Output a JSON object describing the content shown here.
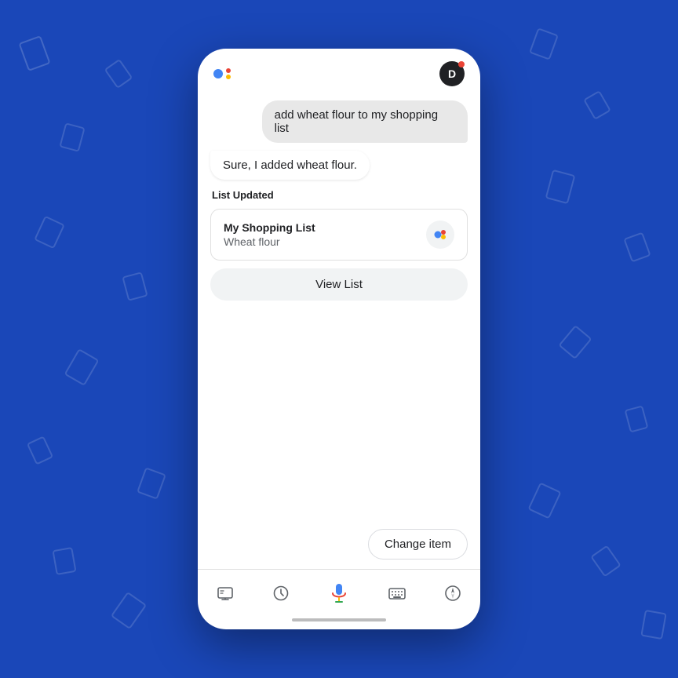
{
  "header": {
    "user_initial": "D",
    "notif": true
  },
  "chat": {
    "user_message": "add wheat flour to my shopping list",
    "assistant_reply": "Sure, I added wheat flour."
  },
  "list_section": {
    "label": "List Updated",
    "card": {
      "title": "My Shopping List",
      "item": "Wheat flour"
    }
  },
  "buttons": {
    "view_list": "View List",
    "change_item": "Change item"
  },
  "toolbar": {
    "icons": [
      "recent-icon",
      "mic-icon",
      "keyboard-icon",
      "compass-icon",
      "snapshot-icon"
    ]
  },
  "colors": {
    "accent_blue": "#4285f4",
    "accent_red": "#ea4335",
    "accent_yellow": "#fbbc04",
    "accent_green": "#34a853",
    "background": "#1a47b8"
  }
}
